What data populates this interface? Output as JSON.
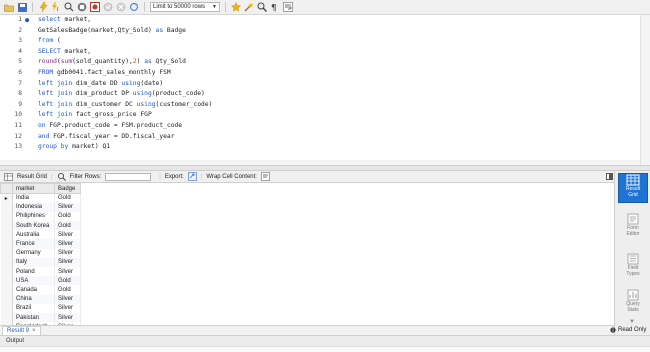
{
  "toolbar": {
    "limit_label": "Limit to 50000 rows",
    "icons": [
      "open-folder-icon",
      "save-icon",
      "execute-icon",
      "execute-line-icon",
      "explain-icon",
      "stop-icon",
      "toggle-autocommit-icon",
      "commit-icon",
      "rollback-icon",
      "limit-select",
      "beautify-icon",
      "find-icon",
      "invisible-chars-icon",
      "wrap-icon"
    ]
  },
  "editor": {
    "lines": [
      {
        "n": "1",
        "dot": "●",
        "segments": [
          {
            "t": "kw",
            "v": "select"
          },
          {
            "t": "id",
            "v": " market,"
          }
        ]
      },
      {
        "n": "2",
        "dot": "",
        "segments": [
          {
            "t": "id",
            "v": "GetSalesBadge(market,Qty_Sold) "
          },
          {
            "t": "kw",
            "v": "as"
          },
          {
            "t": "id",
            "v": " Badge"
          }
        ]
      },
      {
        "n": "3",
        "dot": "",
        "segments": [
          {
            "t": "kw",
            "v": "from"
          },
          {
            "t": "id",
            "v": " ("
          }
        ]
      },
      {
        "n": "4",
        "dot": "",
        "segments": [
          {
            "t": "kw",
            "v": "SELECT"
          },
          {
            "t": "id",
            "v": " market,"
          }
        ]
      },
      {
        "n": "5",
        "dot": "",
        "segments": [
          {
            "t": "fn",
            "v": "round"
          },
          {
            "t": "id",
            "v": "("
          },
          {
            "t": "fn",
            "v": "sum"
          },
          {
            "t": "id",
            "v": "(sold_quantity),"
          },
          {
            "t": "num",
            "v": "2"
          },
          {
            "t": "id",
            "v": ") "
          },
          {
            "t": "kw",
            "v": "as"
          },
          {
            "t": "id",
            "v": " Qty_Sold"
          }
        ]
      },
      {
        "n": "6",
        "dot": "",
        "segments": [
          {
            "t": "kw",
            "v": "FROM"
          },
          {
            "t": "id",
            "v": " gdb0041.fact_sales_monthly FSM"
          }
        ]
      },
      {
        "n": "7",
        "dot": "",
        "segments": [
          {
            "t": "kw",
            "v": "left join"
          },
          {
            "t": "id",
            "v": " dim_date DD "
          },
          {
            "t": "kw",
            "v": "using"
          },
          {
            "t": "id",
            "v": "(date)"
          }
        ]
      },
      {
        "n": "8",
        "dot": "",
        "segments": [
          {
            "t": "kw",
            "v": "left join"
          },
          {
            "t": "id",
            "v": " dim_product DP "
          },
          {
            "t": "kw",
            "v": "using"
          },
          {
            "t": "id",
            "v": "(product_code)"
          }
        ]
      },
      {
        "n": "9",
        "dot": "",
        "segments": [
          {
            "t": "kw",
            "v": "left join"
          },
          {
            "t": "id",
            "v": " dim_customer DC "
          },
          {
            "t": "kw",
            "v": "using"
          },
          {
            "t": "id",
            "v": "(customer_code)"
          }
        ]
      },
      {
        "n": "10",
        "dot": "",
        "segments": [
          {
            "t": "kw",
            "v": "left join"
          },
          {
            "t": "id",
            "v": " fact_gross_price FGP"
          }
        ]
      },
      {
        "n": "11",
        "dot": "",
        "segments": [
          {
            "t": "kw",
            "v": "on"
          },
          {
            "t": "id",
            "v": " FGP.product_code = FSM.product_code"
          }
        ]
      },
      {
        "n": "12",
        "dot": "",
        "segments": [
          {
            "t": "kw",
            "v": "and"
          },
          {
            "t": "id",
            "v": " FGP.fiscal_year = DD.fiscal_year"
          }
        ]
      },
      {
        "n": "13",
        "dot": "",
        "segments": [
          {
            "t": "kw",
            "v": "group by"
          },
          {
            "t": "id",
            "v": " market) Q1"
          }
        ]
      }
    ]
  },
  "result_toolbar": {
    "result_grid_label": "Result Grid",
    "filter_rows_label": "Filter Rows:",
    "filter_value": "",
    "export_label": "Export:",
    "wrap_label": "Wrap Cell Content:"
  },
  "grid": {
    "columns": [
      "market",
      "Badge"
    ],
    "selected_marker": "▸",
    "rows": [
      [
        "India",
        "Gold"
      ],
      [
        "Indonesia",
        "Silver"
      ],
      [
        "Philiphines",
        "Gold"
      ],
      [
        "South Korea",
        "Gold"
      ],
      [
        "Australia",
        "Silver"
      ],
      [
        "France",
        "Silver"
      ],
      [
        "Germany",
        "Silver"
      ],
      [
        "Italy",
        "Silver"
      ],
      [
        "Poland",
        "Silver"
      ],
      [
        "USA",
        "Gold"
      ],
      [
        "Canada",
        "Gold"
      ],
      [
        "China",
        "Silver"
      ],
      [
        "Brazil",
        "Silver"
      ],
      [
        "Pakistan",
        "Silver"
      ],
      [
        "Bangladesh",
        "Silver"
      ]
    ]
  },
  "side_panel": {
    "buttons": [
      {
        "name": "result-grid",
        "line1": "Result",
        "line2": "Grid"
      },
      {
        "name": "form-editor",
        "line1": "Form",
        "line2": "Editor"
      },
      {
        "name": "field-types",
        "line1": "Field",
        "line2": "Types"
      },
      {
        "name": "query-stats",
        "line1": "Query",
        "line2": "Stats"
      }
    ]
  },
  "result_tabs": {
    "tab_label": "Result 9",
    "close_glyph": "×",
    "read_only_label": "Read Only"
  },
  "output": {
    "label": "Output"
  },
  "colors": {
    "accent": "#1f73d2",
    "keyword": "#1e58c4"
  }
}
